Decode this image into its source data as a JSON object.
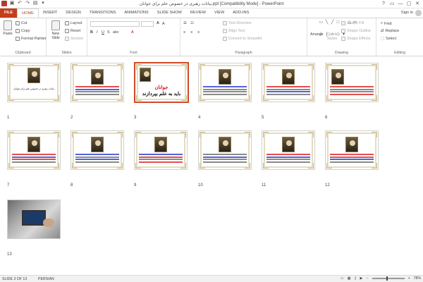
{
  "window": {
    "title": "بیانات رهبری در خصوص علم برای جوانان.ppt [Compatibility Mode] - PowerPoint",
    "controls": [
      "?",
      "▭",
      "—",
      "▢",
      "✕"
    ]
  },
  "tabs": [
    "FILE",
    "HOME",
    "INSERT",
    "DESIGN",
    "TRANSITIONS",
    "ANIMATIONS",
    "SLIDE SHOW",
    "REVIEW",
    "VIEW",
    "ADD-INS"
  ],
  "active_tab": "HOME",
  "sign_in": "Sign in",
  "ribbon": {
    "clipboard": {
      "label": "Clipboard",
      "paste": "Paste",
      "cut": "Cut",
      "copy": "Copy",
      "format_painter": "Format Painter"
    },
    "slides": {
      "label": "Slides",
      "new_slide": "New Slide",
      "layout": "Layout",
      "reset": "Reset",
      "section": "Section"
    },
    "font": {
      "label": "Font"
    },
    "paragraph": {
      "label": "Paragraph",
      "text_direction": "Text Direction",
      "align_text": "Align Text",
      "convert": "Convert to SmartArt"
    },
    "drawing": {
      "label": "Drawing",
      "arrange": "Arrange",
      "quick_styles": "Quick Styles",
      "shape_fill": "Shape Fill",
      "shape_outline": "Shape Outline",
      "shape_effects": "Shape Effects"
    },
    "editing": {
      "label": "Editing",
      "find": "Find",
      "replace": "Replace",
      "select": "Select"
    }
  },
  "slides": [
    {
      "n": "1",
      "title": "بیانات رهبری در خصوص علم برای جوانان"
    },
    {
      "n": "2"
    },
    {
      "n": "3",
      "big_line1": "جوانان",
      "big_line2": "باید به علم بپردازند"
    },
    {
      "n": "4"
    },
    {
      "n": "5"
    },
    {
      "n": "6"
    },
    {
      "n": "7"
    },
    {
      "n": "8"
    },
    {
      "n": "9"
    },
    {
      "n": "10"
    },
    {
      "n": "11"
    },
    {
      "n": "12"
    },
    {
      "n": "13"
    }
  ],
  "status": {
    "slide_of": "SLIDE 3 OF 13",
    "language": "PERSIAN",
    "zoom": "78%"
  }
}
